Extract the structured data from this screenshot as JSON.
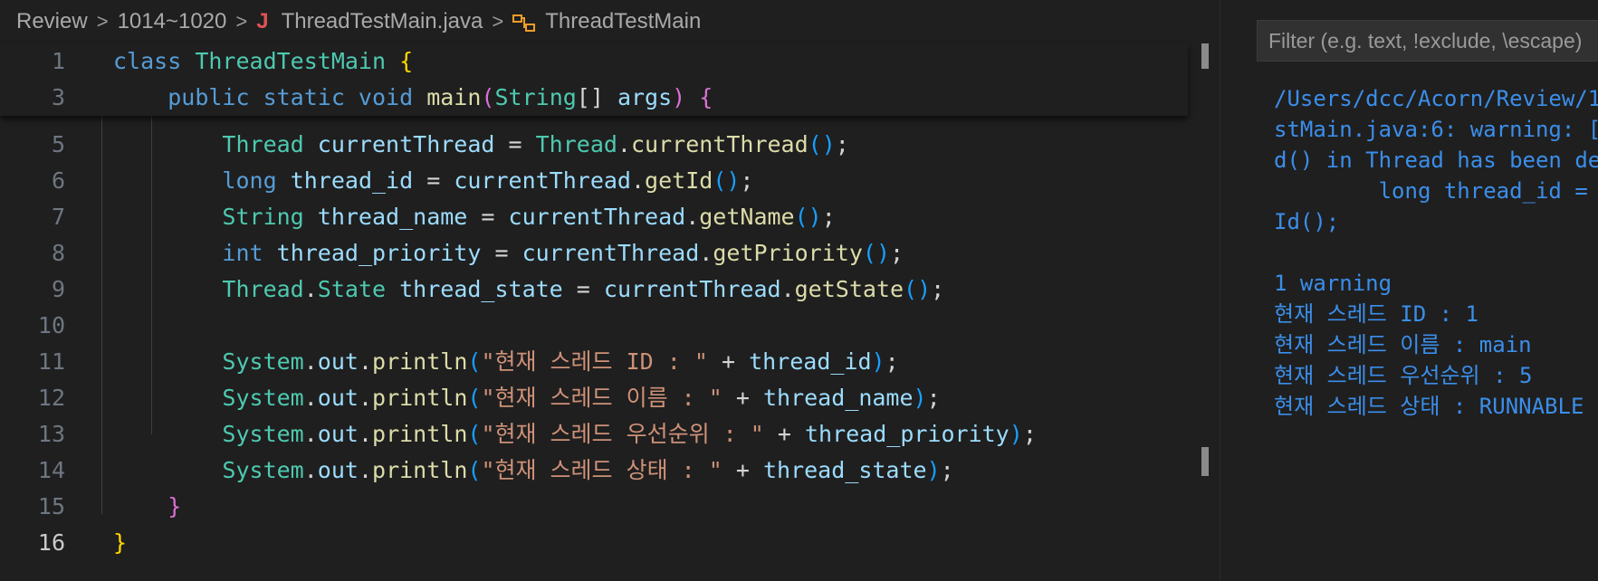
{
  "breadcrumb": {
    "items": [
      "Review",
      "1014~1020",
      "ThreadTestMain.java",
      "ThreadTestMain"
    ],
    "separator": ">",
    "java_icon": "J"
  },
  "editor": {
    "active_line": "16",
    "lines": [
      {
        "n": "1",
        "tokens": [
          {
            "t": "class ",
            "c": "kw"
          },
          {
            "t": "ThreadTestMain",
            "c": "ty"
          },
          {
            "t": " "
          },
          {
            "t": "{",
            "c": "b1"
          }
        ]
      },
      {
        "n": "3",
        "tokens": [
          {
            "t": "    "
          },
          {
            "t": "public static void ",
            "c": "kw"
          },
          {
            "t": "main",
            "c": "fn"
          },
          {
            "t": "(",
            "c": "b2"
          },
          {
            "t": "String",
            "c": "ty"
          },
          {
            "t": "[] ",
            "c": "pl"
          },
          {
            "t": "args",
            "c": "va"
          },
          {
            "t": ") ",
            "c": "b2"
          },
          {
            "t": "{",
            "c": "b2"
          }
        ]
      },
      {
        "n": "5",
        "tokens": [
          {
            "t": "        "
          },
          {
            "t": "Thread ",
            "c": "ty"
          },
          {
            "t": "currentThread ",
            "c": "va"
          },
          {
            "t": "= ",
            "c": "pl"
          },
          {
            "t": "Thread",
            "c": "ty"
          },
          {
            "t": ".",
            "c": "pl"
          },
          {
            "t": "currentThread",
            "c": "fn"
          },
          {
            "t": "()",
            "c": "b3"
          },
          {
            "t": ";",
            "c": "pl"
          }
        ]
      },
      {
        "n": "6",
        "tokens": [
          {
            "t": "        "
          },
          {
            "t": "long ",
            "c": "kw"
          },
          {
            "t": "thread_id ",
            "c": "va"
          },
          {
            "t": "= ",
            "c": "pl"
          },
          {
            "t": "currentThread",
            "c": "va"
          },
          {
            "t": ".",
            "c": "pl"
          },
          {
            "t": "getId",
            "c": "fn"
          },
          {
            "t": "()",
            "c": "b3"
          },
          {
            "t": ";",
            "c": "pl"
          }
        ]
      },
      {
        "n": "7",
        "tokens": [
          {
            "t": "        "
          },
          {
            "t": "String ",
            "c": "ty"
          },
          {
            "t": "thread_name ",
            "c": "va"
          },
          {
            "t": "= ",
            "c": "pl"
          },
          {
            "t": "currentThread",
            "c": "va"
          },
          {
            "t": ".",
            "c": "pl"
          },
          {
            "t": "getName",
            "c": "fn"
          },
          {
            "t": "()",
            "c": "b3"
          },
          {
            "t": ";",
            "c": "pl"
          }
        ]
      },
      {
        "n": "8",
        "tokens": [
          {
            "t": "        "
          },
          {
            "t": "int ",
            "c": "kw"
          },
          {
            "t": "thread_priority ",
            "c": "va"
          },
          {
            "t": "= ",
            "c": "pl"
          },
          {
            "t": "currentThread",
            "c": "va"
          },
          {
            "t": ".",
            "c": "pl"
          },
          {
            "t": "getPriority",
            "c": "fn"
          },
          {
            "t": "()",
            "c": "b3"
          },
          {
            "t": ";",
            "c": "pl"
          }
        ]
      },
      {
        "n": "9",
        "tokens": [
          {
            "t": "        "
          },
          {
            "t": "Thread",
            "c": "ty"
          },
          {
            "t": ".",
            "c": "pl"
          },
          {
            "t": "State ",
            "c": "ty"
          },
          {
            "t": "thread_state ",
            "c": "va"
          },
          {
            "t": "= ",
            "c": "pl"
          },
          {
            "t": "currentThread",
            "c": "va"
          },
          {
            "t": ".",
            "c": "pl"
          },
          {
            "t": "getState",
            "c": "fn"
          },
          {
            "t": "()",
            "c": "b3"
          },
          {
            "t": ";",
            "c": "pl"
          }
        ]
      },
      {
        "n": "10",
        "tokens": []
      },
      {
        "n": "11",
        "tokens": [
          {
            "t": "        "
          },
          {
            "t": "System",
            "c": "ty"
          },
          {
            "t": ".",
            "c": "pl"
          },
          {
            "t": "out",
            "c": "va"
          },
          {
            "t": ".",
            "c": "pl"
          },
          {
            "t": "println",
            "c": "fn"
          },
          {
            "t": "(",
            "c": "b3"
          },
          {
            "t": "\"현재 스레드 ID : \"",
            "c": "st"
          },
          {
            "t": " + ",
            "c": "pl"
          },
          {
            "t": "thread_id",
            "c": "va"
          },
          {
            "t": ")",
            "c": "b3"
          },
          {
            "t": ";",
            "c": "pl"
          }
        ]
      },
      {
        "n": "12",
        "tokens": [
          {
            "t": "        "
          },
          {
            "t": "System",
            "c": "ty"
          },
          {
            "t": ".",
            "c": "pl"
          },
          {
            "t": "out",
            "c": "va"
          },
          {
            "t": ".",
            "c": "pl"
          },
          {
            "t": "println",
            "c": "fn"
          },
          {
            "t": "(",
            "c": "b3"
          },
          {
            "t": "\"현재 스레드 이름 : \"",
            "c": "st"
          },
          {
            "t": " + ",
            "c": "pl"
          },
          {
            "t": "thread_name",
            "c": "va"
          },
          {
            "t": ")",
            "c": "b3"
          },
          {
            "t": ";",
            "c": "pl"
          }
        ]
      },
      {
        "n": "13",
        "tokens": [
          {
            "t": "        "
          },
          {
            "t": "System",
            "c": "ty"
          },
          {
            "t": ".",
            "c": "pl"
          },
          {
            "t": "out",
            "c": "va"
          },
          {
            "t": ".",
            "c": "pl"
          },
          {
            "t": "println",
            "c": "fn"
          },
          {
            "t": "(",
            "c": "b3"
          },
          {
            "t": "\"현재 스레드 우선순위 : \"",
            "c": "st"
          },
          {
            "t": " + ",
            "c": "pl"
          },
          {
            "t": "thread_priority",
            "c": "va"
          },
          {
            "t": ")",
            "c": "b3"
          },
          {
            "t": ";",
            "c": "pl"
          }
        ]
      },
      {
        "n": "14",
        "tokens": [
          {
            "t": "        "
          },
          {
            "t": "System",
            "c": "ty"
          },
          {
            "t": ".",
            "c": "pl"
          },
          {
            "t": "out",
            "c": "va"
          },
          {
            "t": ".",
            "c": "pl"
          },
          {
            "t": "println",
            "c": "fn"
          },
          {
            "t": "(",
            "c": "b3"
          },
          {
            "t": "\"현재 스레드 상태 : \"",
            "c": "st"
          },
          {
            "t": " + ",
            "c": "pl"
          },
          {
            "t": "thread_state",
            "c": "va"
          },
          {
            "t": ")",
            "c": "b3"
          },
          {
            "t": ";",
            "c": "pl"
          }
        ]
      },
      {
        "n": "15",
        "tokens": [
          {
            "t": "    "
          },
          {
            "t": "}",
            "c": "b2"
          }
        ]
      },
      {
        "n": "16",
        "tokens": [
          {
            "t": "}",
            "c": "b1"
          }
        ]
      }
    ]
  },
  "output": {
    "filter_placeholder": "Filter (e.g. text, !exclude, \\escape)",
    "lines": [
      "/Users/dcc/Acorn/Review/1",
      "stMain.java:6: warning: [",
      "d() in Thread has been de",
      "        long thread_id =",
      "Id();",
      "",
      "1 warning",
      "현재 스레드 ID : 1",
      "현재 스레드 이름 : main",
      "현재 스레드 우선순위 : 5",
      "현재 스레드 상태 : RUNNABLE"
    ]
  },
  "colors": {
    "keyword": "#569cd6",
    "type": "#4ec9b0",
    "function": "#dcdcaa",
    "variable": "#9cdcfe",
    "string": "#ce9178",
    "output_text": "#3b8eea",
    "background": "#1f1f1f"
  }
}
